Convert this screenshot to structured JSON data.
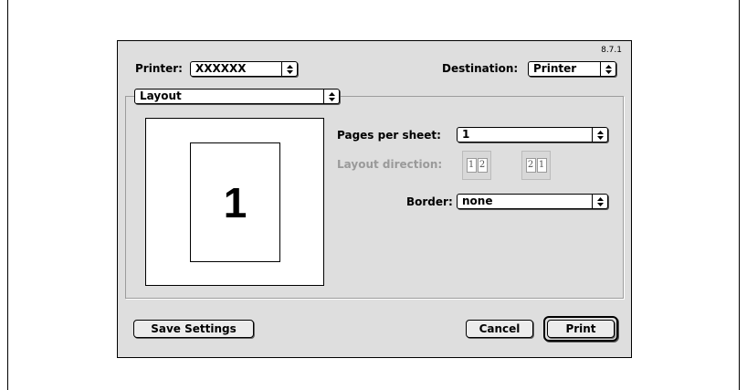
{
  "version": "8.7.1",
  "printer": {
    "label": "Printer:",
    "value": "XXXXXX"
  },
  "destination": {
    "label": "Destination:",
    "value": "Printer"
  },
  "panel_menu": {
    "value": "Layout"
  },
  "preview": {
    "page_number": "1"
  },
  "pages_per_sheet": {
    "label": "Pages per sheet:",
    "value": "1"
  },
  "layout_direction": {
    "label": "Layout direction:",
    "options": [
      {
        "pages": [
          "1",
          "2"
        ]
      },
      {
        "pages": [
          "2",
          "1"
        ]
      }
    ]
  },
  "border": {
    "label": "Border:",
    "value": "none"
  },
  "buttons": {
    "save_settings": "Save Settings",
    "cancel": "Cancel",
    "print": "Print"
  }
}
